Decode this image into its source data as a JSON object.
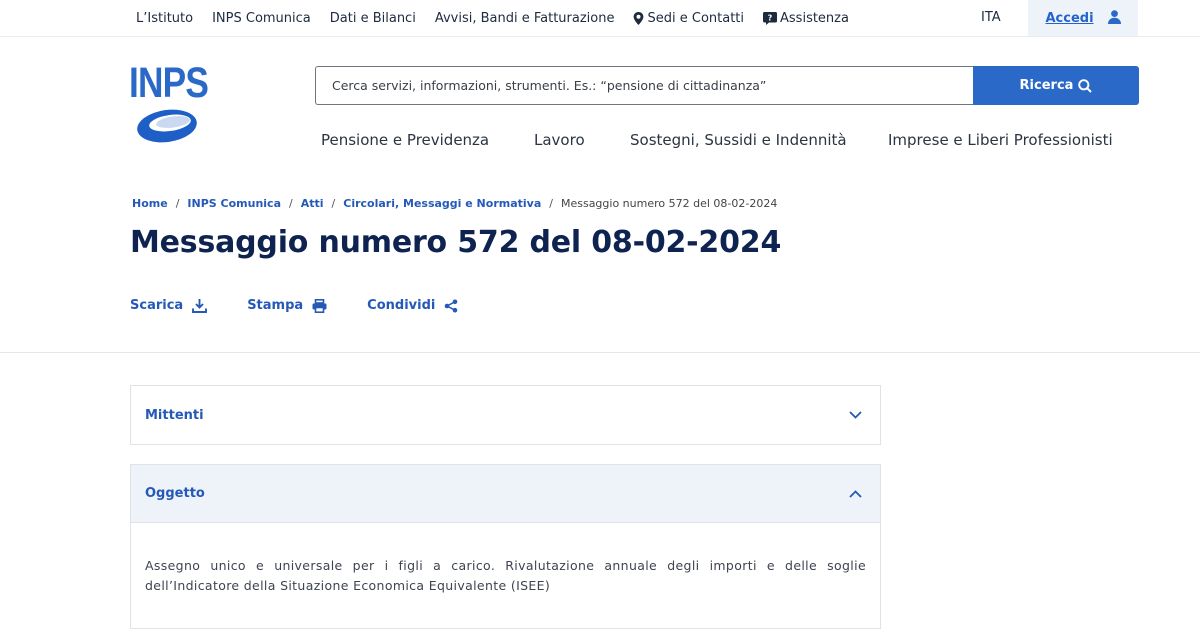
{
  "topbar": {
    "links": [
      "L’Istituto",
      "INPS Comunica",
      "Dati e Bilanci",
      "Avvisi, Bandi e Fatturazione",
      "Sedi e Contatti",
      "Assistenza"
    ],
    "language": "ITA",
    "login_label": "Accedi"
  },
  "header": {
    "logo_text": "INPS",
    "search_placeholder": "Cerca servizi, informazioni, strumenti. Es.: “pensione di cittadinanza”",
    "search_button": "Ricerca",
    "nav": [
      "Pensione e Previdenza",
      "Lavoro",
      "Sostegni, Sussidi e Indennità",
      "Imprese e Liberi Professionisti"
    ]
  },
  "breadcrumb": {
    "items": [
      "Home",
      "INPS Comunica",
      "Atti",
      "Circolari, Messaggi e Normativa"
    ],
    "current": "Messaggio numero 572 del 08-02-2024"
  },
  "page": {
    "title": "Messaggio numero 572 del 08-02-2024",
    "actions": [
      "Scarica",
      "Stampa",
      "Condividi"
    ]
  },
  "accordion": [
    {
      "title": "Mittenti",
      "expanded": false
    },
    {
      "title": "Oggetto",
      "expanded": true,
      "body": "Assegno unico e universale per i figli a carico. Rivalutazione annuale degli importi e delle soglie dell’Indicatore della Situazione Economica Equivalente (ISEE)"
    }
  ],
  "colors": {
    "brand_blue": "#2a69c8",
    "link_blue": "#2559b8",
    "title_navy": "#0e2350",
    "panel_bg": "#eef2f9"
  }
}
